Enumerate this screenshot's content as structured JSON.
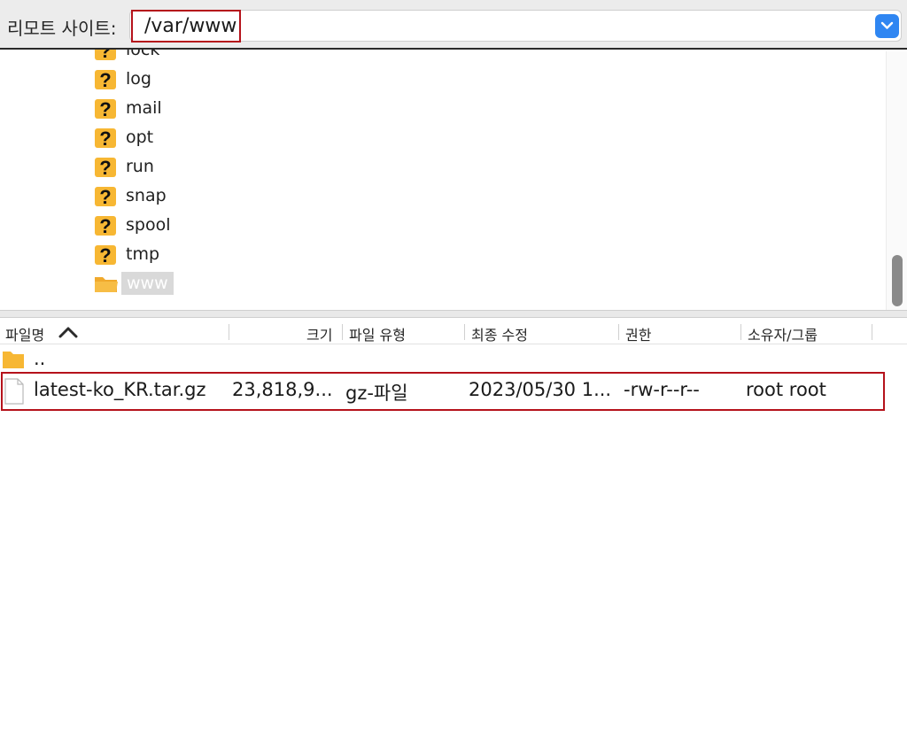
{
  "address": {
    "label": "리모트 사이트:",
    "value": "/var/www"
  },
  "tree": {
    "items": [
      {
        "name": "lock",
        "icon": "question-folder-icon"
      },
      {
        "name": "log",
        "icon": "question-folder-icon"
      },
      {
        "name": "mail",
        "icon": "question-folder-icon"
      },
      {
        "name": "opt",
        "icon": "question-folder-icon"
      },
      {
        "name": "run",
        "icon": "question-folder-icon"
      },
      {
        "name": "snap",
        "icon": "question-folder-icon"
      },
      {
        "name": "spool",
        "icon": "question-folder-icon"
      },
      {
        "name": "tmp",
        "icon": "question-folder-icon"
      },
      {
        "name": "www",
        "icon": "open-folder-icon",
        "selected": true
      }
    ]
  },
  "file_list": {
    "columns": {
      "name": "파일명",
      "size": "크기",
      "type": "파일 유형",
      "modified": "최종 수정",
      "permissions": "권한",
      "owner": "소유자/그룹"
    },
    "parent_row": {
      "name": ".."
    },
    "rows": [
      {
        "name": "latest-ko_KR.tar.gz",
        "size": "23,818,9...",
        "type": "gz-파일",
        "modified": "2023/05/30 1...",
        "permissions": "-rw-r--r--",
        "owner": "root root"
      }
    ]
  },
  "colors": {
    "accent": "#2f86f2",
    "highlight_border": "#b5121b",
    "folder_yellow": "#f7b733"
  }
}
